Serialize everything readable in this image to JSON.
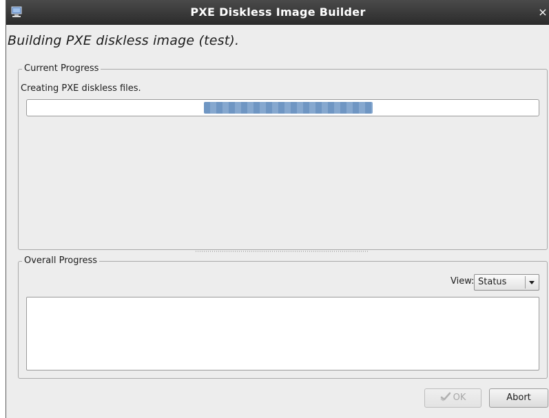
{
  "window": {
    "title": "PXE Diskless Image Builder",
    "close_glyph": "×",
    "app_icon": "computer-icon"
  },
  "heading": "Building PXE diskless image (test).",
  "current_progress": {
    "legend": "Current Progress",
    "status_text": "Creating PXE diskless files.",
    "progress_mode": "indeterminate",
    "bar_color": "#7a9fca"
  },
  "overall_progress": {
    "legend": "Overall Progress",
    "view_label": "View:",
    "view_selected": "Status",
    "log_text": ""
  },
  "buttons": {
    "ok_label": "OK",
    "ok_enabled": false,
    "ok_icon": "ok-check-icon",
    "abort_label": "Abort"
  }
}
